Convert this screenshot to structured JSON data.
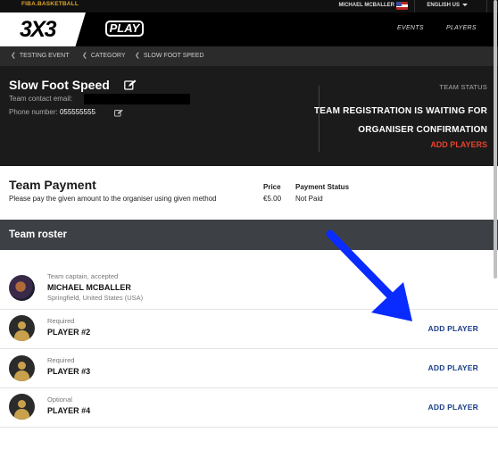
{
  "topbar": {
    "brand": "FIBA.BASKETBALL",
    "user": "MICHAEL MCBALLER",
    "language": "ENGLISH US"
  },
  "nav": {
    "logo_text": "3X3",
    "play_logo": "PLAY",
    "events": "EVENTS",
    "players": "PLAYERS"
  },
  "breadcrumbs": [
    "TESTING EVENT",
    "CATEGORY",
    "SLOW FOOT SPEED"
  ],
  "team": {
    "name": "Slow Foot Speed",
    "contact_label": "Team contact email:",
    "phone_label": "Phone number:",
    "phone": "055555555",
    "status_label": "TEAM STATUS",
    "status_line1": "TEAM REGISTRATION IS WAITING FOR",
    "status_line2": "ORGANISER CONFIRMATION",
    "add_players": "ADD PLAYERS"
  },
  "payment": {
    "title": "Team Payment",
    "description": "Please pay the given amount to the organiser using given method",
    "price_label": "Price",
    "price": "€5.00",
    "status_label": "Payment Status",
    "status": "Not Paid"
  },
  "roster": {
    "title": "Team roster",
    "captain": {
      "role": "Team captain, accepted",
      "name": "MICHAEL MCBALLER",
      "location": "Springfield, United States (USA)"
    },
    "slots": [
      {
        "role": "Required",
        "name": "PLAYER #2",
        "action": "ADD PLAYER"
      },
      {
        "role": "Required",
        "name": "PLAYER #3",
        "action": "ADD PLAYER"
      },
      {
        "role": "Optional",
        "name": "PLAYER #4",
        "action": "ADD PLAYER"
      }
    ]
  },
  "colors": {
    "accent_red": "#e8412c",
    "link_blue": "#1c3f8a",
    "annotation_arrow": "#0a2bff"
  }
}
